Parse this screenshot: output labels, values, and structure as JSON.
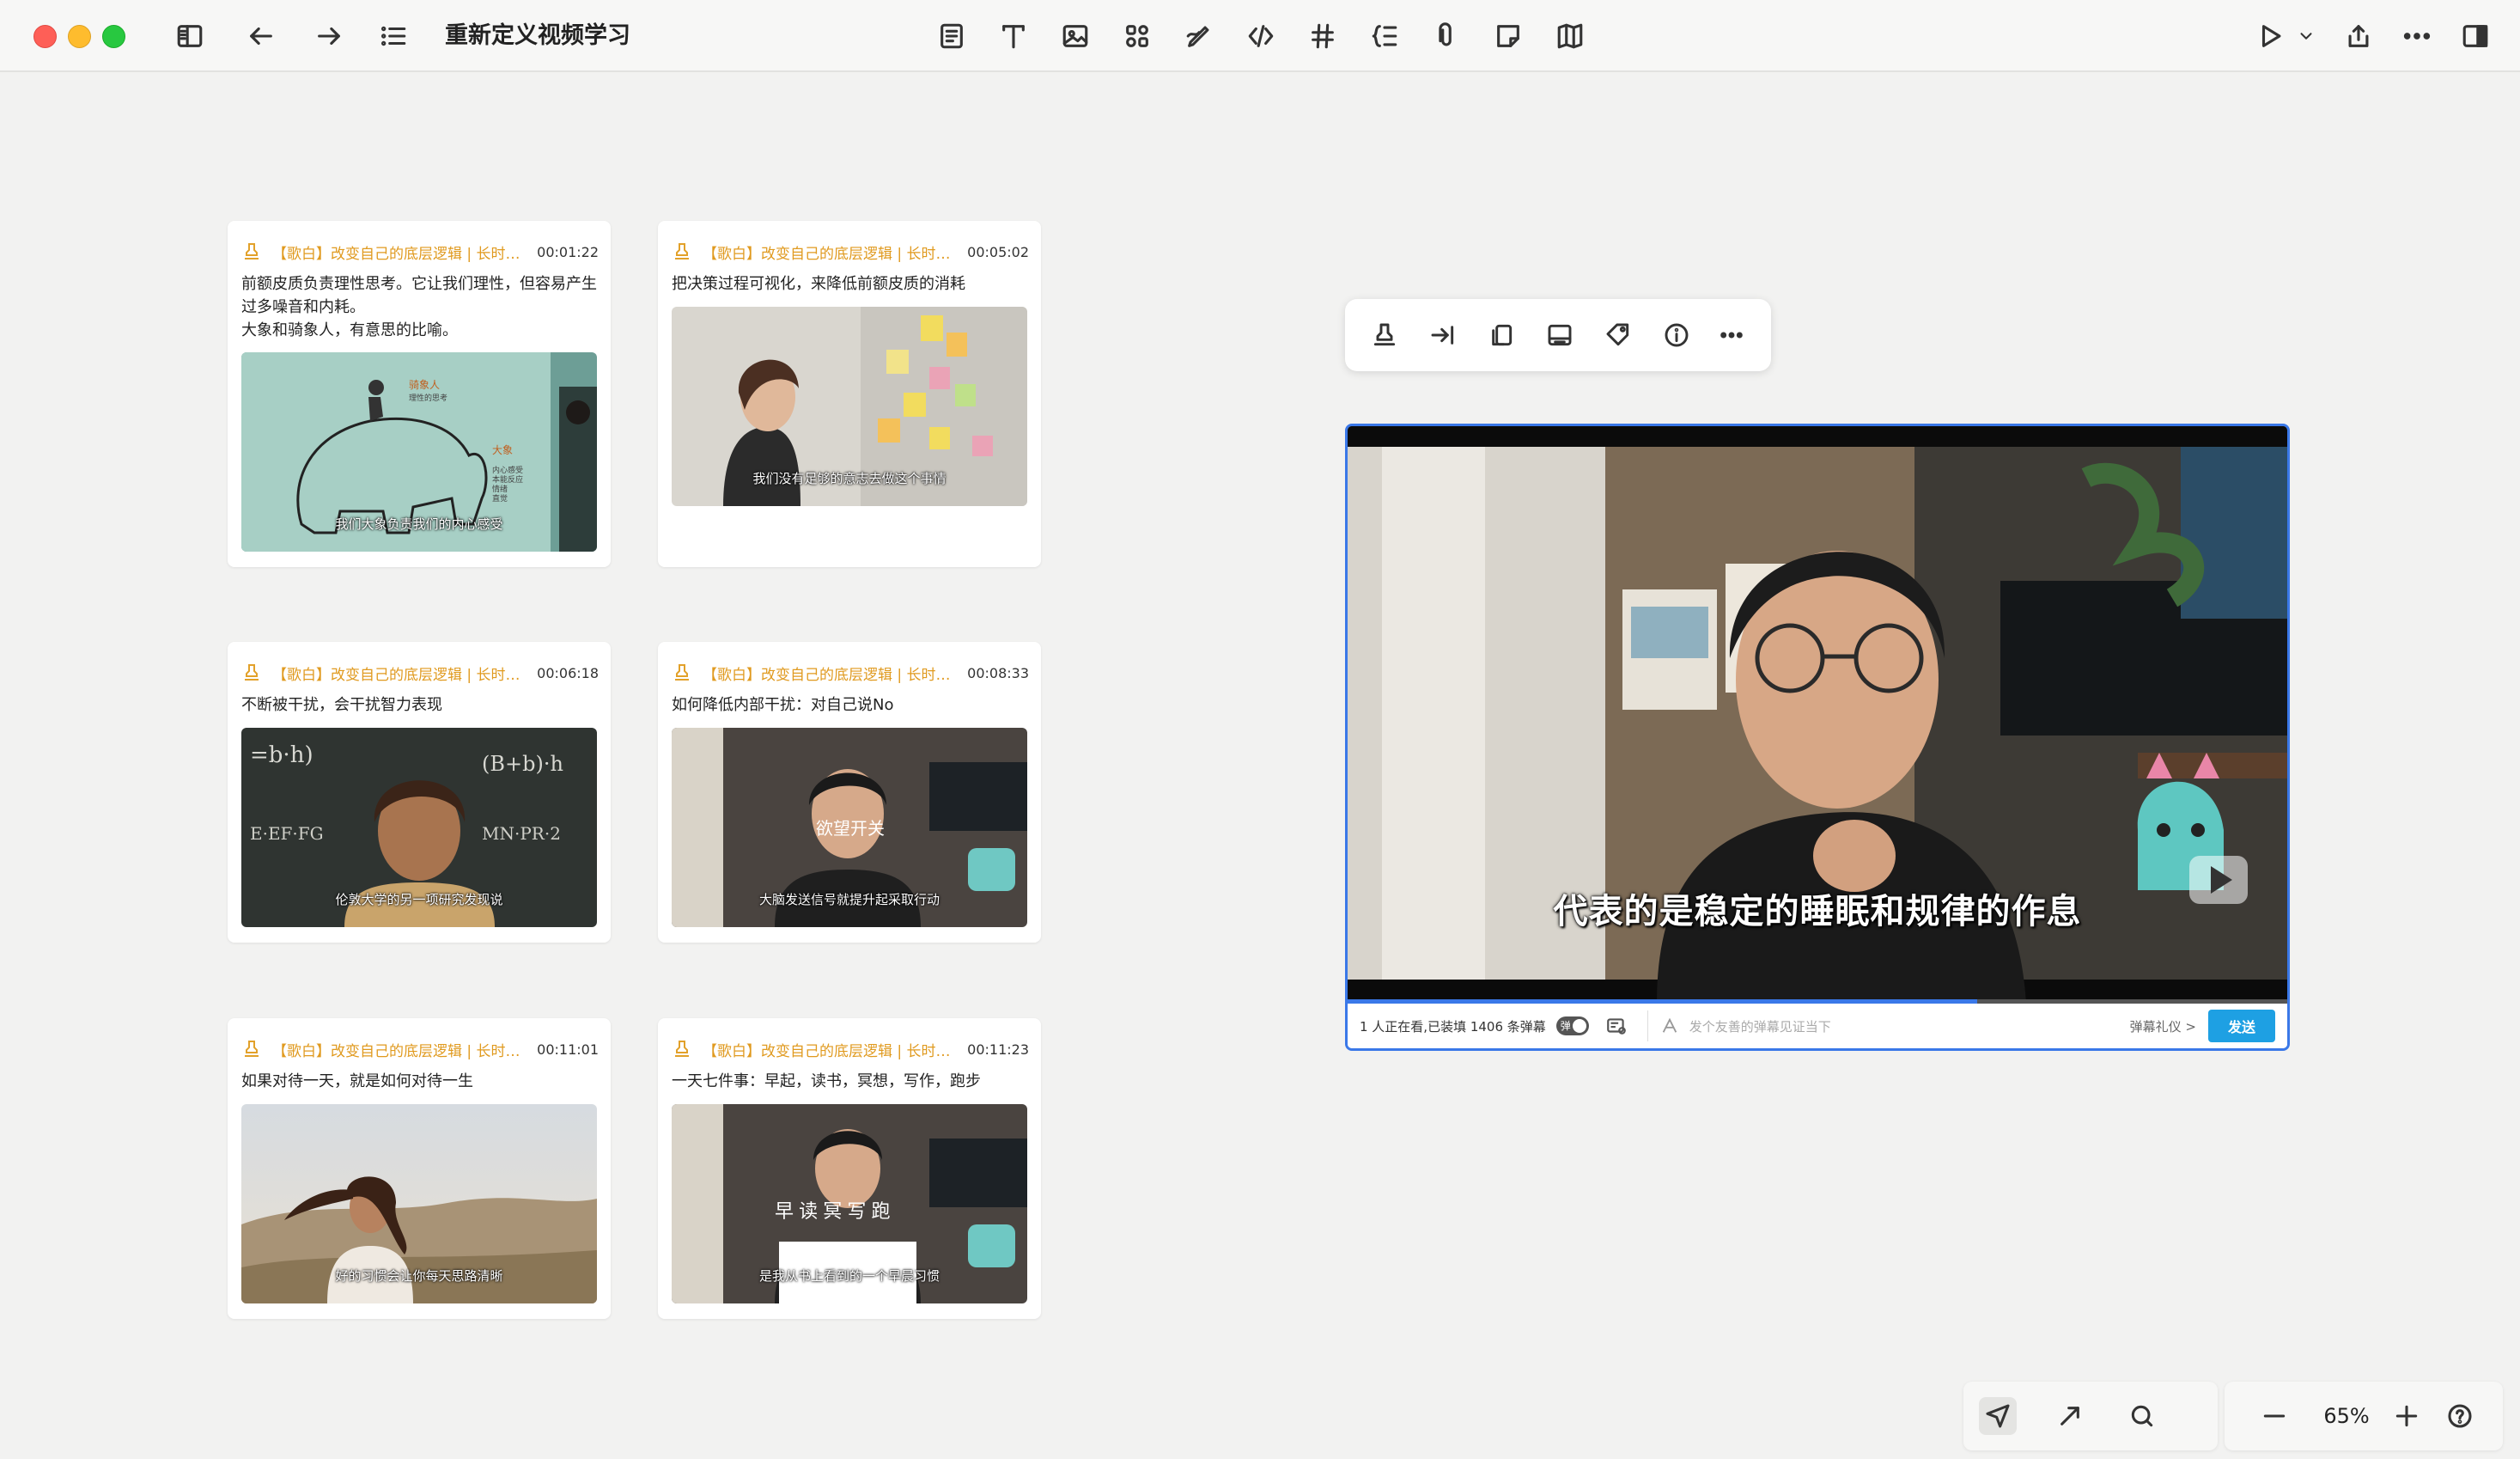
{
  "window": {
    "title": "重新定义视频学习",
    "toolbar_icons": [
      "sidebar-icon",
      "back-arrow-icon",
      "forward-arrow-icon",
      "outline-list-icon",
      "page-icon",
      "text-icon",
      "image-icon",
      "components-icon",
      "pen-icon",
      "code-icon",
      "hashtag-icon",
      "indent-icon",
      "attachment-icon",
      "sticky-note-icon",
      "map-icon",
      "play-icon",
      "chevron-down-icon",
      "share-icon",
      "more-icon",
      "right-panel-icon"
    ]
  },
  "cards": [
    {
      "source": "【歌白】改变自己的底层逻辑 | 长时间...",
      "time": "00:01:22",
      "text": "前额皮质负责理性思考。它让我们理性，但容易产生过多噪音和内耗。\n大象和骑象人，有意思的比喻。",
      "caption": "我们大象负责我们的内心感受",
      "thumb_labels": {
        "rider": "骑象人",
        "rider_sub": "理性的思考",
        "elephant": "大象",
        "elephant_sub": "内心感受\n本能反应\n情绪\n直觉"
      }
    },
    {
      "source": "【歌白】改变自己的底层逻辑 | 长时间...",
      "time": "00:05:02",
      "text": "把决策过程可视化，来降低前额皮质的消耗",
      "caption": "我们没有足够的意志去做这个事情"
    },
    {
      "source": "【歌白】改变自己的底层逻辑 | 长时间...",
      "time": "00:06:18",
      "text": "不断被干扰，会干扰智力表现",
      "caption": "伦敦大学的另一项研究发现说"
    },
    {
      "source": "【歌白】改变自己的底层逻辑 | 长时间...",
      "time": "00:08:33",
      "text": "如何降低内部干扰：对自己说No",
      "caption": "大脑发送信号就提升起采取行动",
      "thumb_overlay": "欲望开关"
    },
    {
      "source": "【歌白】改变自己的底层逻辑 | 长时间...",
      "time": "00:11:01",
      "text": "如果对待一天，就是如何对待一生",
      "caption": "好的习惯会让你每天思路清晰"
    },
    {
      "source": "【歌白】改变自己的底层逻辑 | 长时间...",
      "time": "00:11:23",
      "text": "一天七件事：早起，读书，冥想，写作，跑步",
      "caption": "是我从书上看到的一个早晨习惯",
      "thumb_overlay": "早 读 冥 写 跑"
    }
  ],
  "float_toolbar": {
    "icons": [
      "stamp-icon",
      "jump-to-icon",
      "copy-icon",
      "subtitle-icon",
      "tag-icon",
      "info-icon",
      "more-icon"
    ]
  },
  "player": {
    "subtitle": "代表的是稳定的睡眠和规律的作息",
    "progress": 0.67,
    "viewers": "1 人正在看,已装填 1406 条弹幕",
    "toggle_label": "弹",
    "danmaku_placeholder": "发个友善的弹幕见证当下",
    "etiquette": "弹幕礼仪 >",
    "send": "发送"
  },
  "bottom": {
    "tools": [
      "send-icon",
      "arrow-icon",
      "search-icon"
    ],
    "zoom": "65%",
    "zoom_icons": [
      "zoom-out-icon",
      "zoom-in-icon",
      "help-icon"
    ]
  },
  "colors": {
    "accent": "#3a78e8",
    "card_source": "#e09a1f",
    "send_button": "#1ea0e3"
  }
}
